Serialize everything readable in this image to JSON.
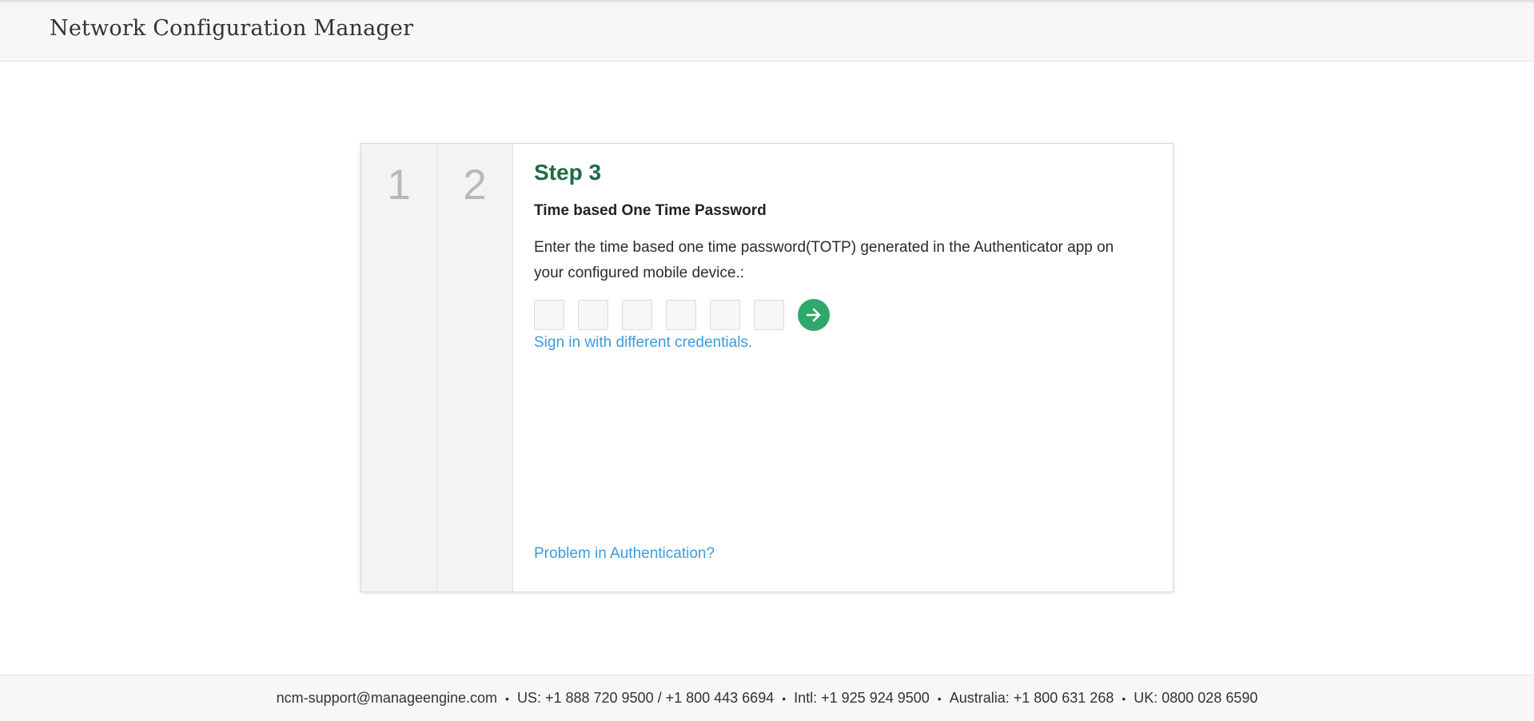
{
  "header": {
    "title": "Network Configuration Manager"
  },
  "steps": {
    "completed": [
      "1",
      "2"
    ]
  },
  "content": {
    "step_title": "Step 3",
    "subtitle": "Time based One Time Password",
    "instructions": "Enter the time based one time password(TOTP) generated in the Authenticator app on your configured mobile device.:",
    "otp_digits": [
      "",
      "",
      "",
      "",
      "",
      ""
    ],
    "submit_icon": "arrow-right-icon",
    "alt_credentials_link": "Sign in with different credentials.",
    "problem_link": "Problem in Authentication?"
  },
  "footer": {
    "items": [
      "ncm-support@manageengine.com",
      "US: +1 888 720 9500 / +1 800 443 6694",
      "Intl: +1 925 924 9500",
      "Australia: +1 800 631 268",
      "UK: 0800 028 6590"
    ],
    "separator": "•"
  },
  "colors": {
    "step_title": "#1f6b43",
    "submit_button": "#2ea76a",
    "link": "#3b9be0",
    "step_number": "#b8b8b8"
  }
}
